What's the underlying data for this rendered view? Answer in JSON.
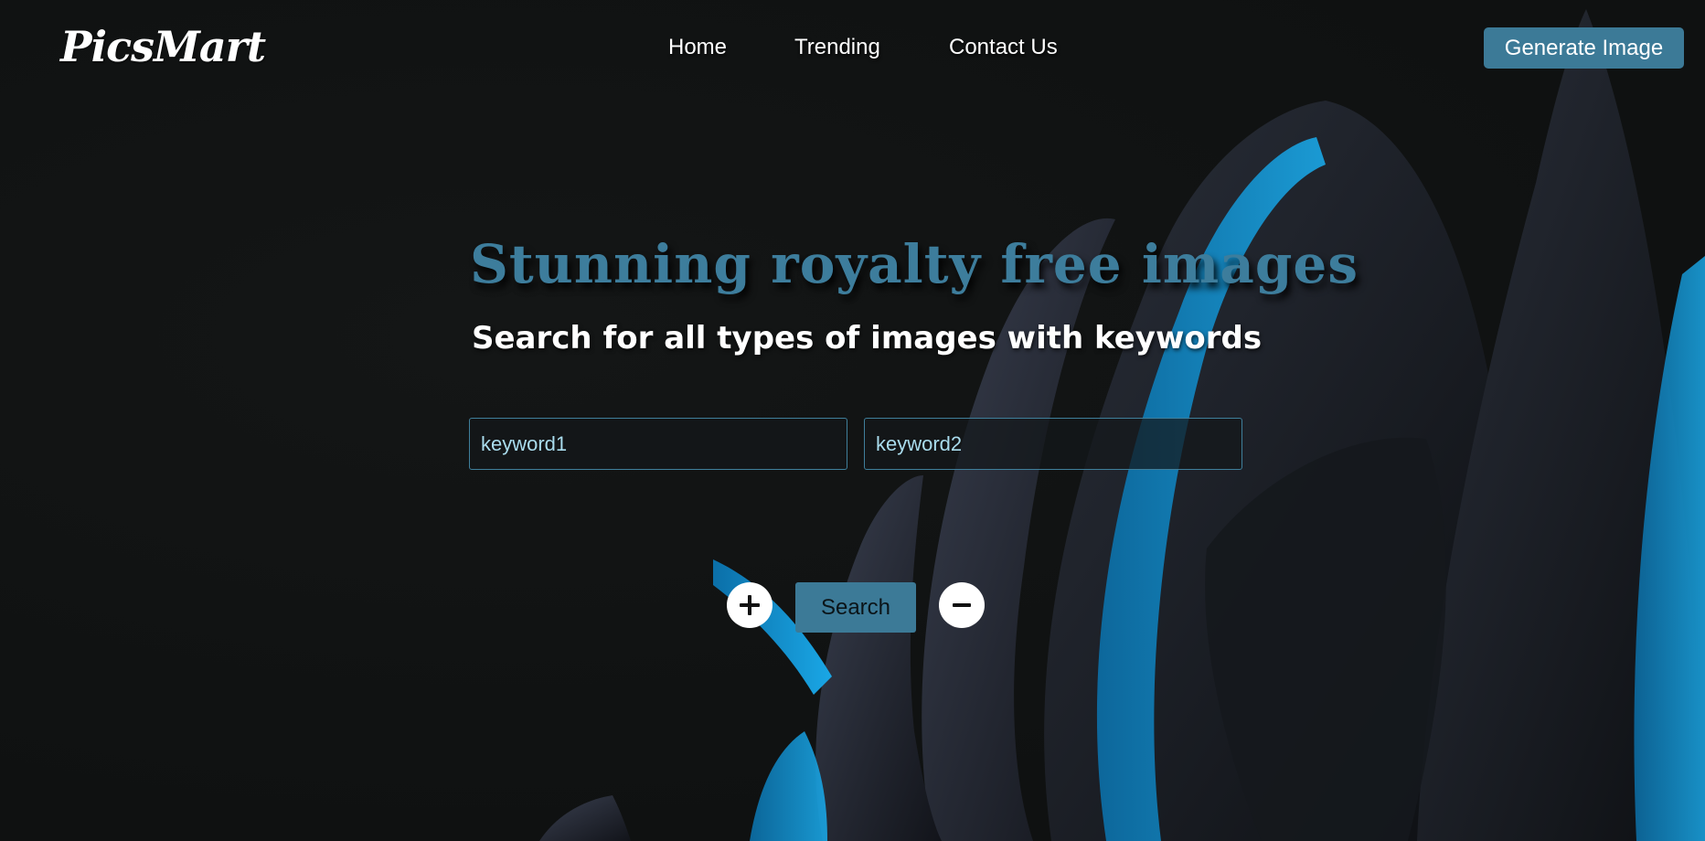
{
  "brand": {
    "logo": "PicsMart"
  },
  "nav": {
    "items": [
      {
        "label": "Home"
      },
      {
        "label": "Trending"
      },
      {
        "label": "Contact Us"
      }
    ],
    "cta_label": "Generate Image"
  },
  "hero": {
    "title": "Stunning royalty free images",
    "subtitle": "Search for all types of images with keywords"
  },
  "search": {
    "keyword1_placeholder": "keyword1",
    "keyword2_placeholder": "keyword2",
    "search_label": "Search",
    "add_icon": "plus-icon",
    "remove_icon": "minus-icon"
  },
  "colors": {
    "accent": "#3c7a97",
    "title": "#3d7d9c",
    "background": "#111313",
    "input_border": "#3f7f9b"
  }
}
